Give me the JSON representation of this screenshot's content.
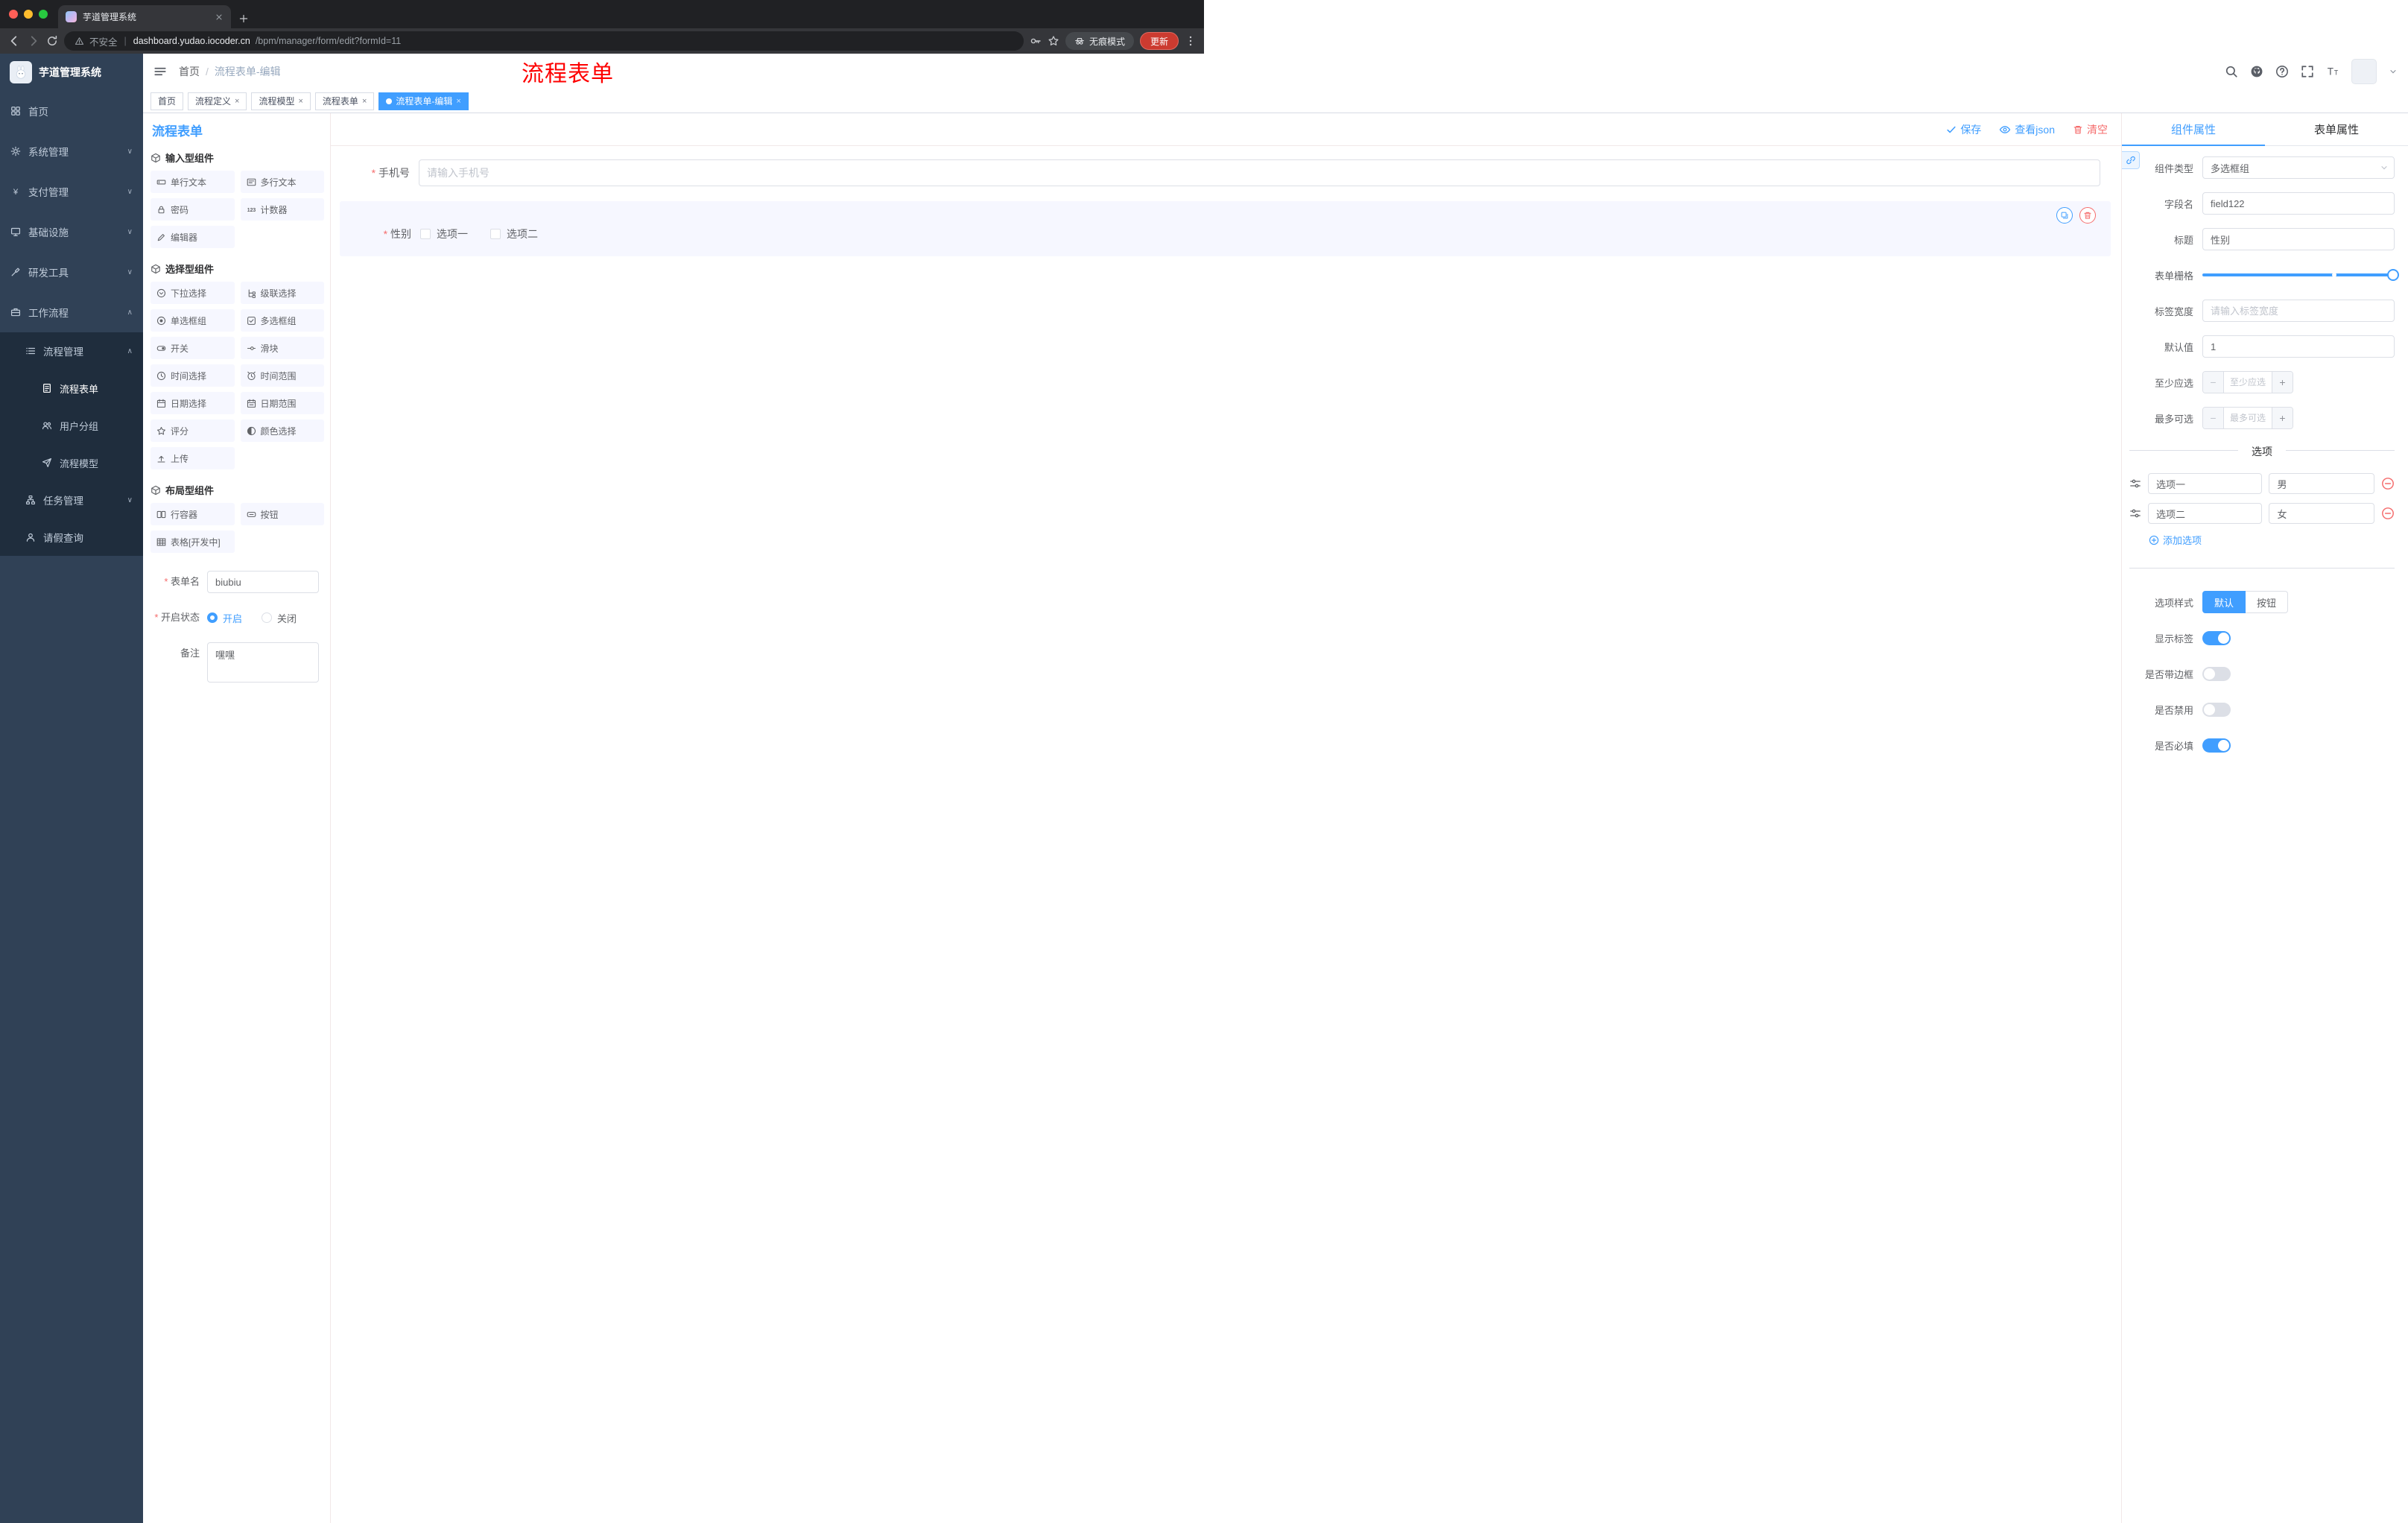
{
  "colors": {
    "accent": "#409eff",
    "danger": "#f56c6c",
    "annotation_red": "#fe0000",
    "sidebar_bg": "#304156",
    "sidebar_submenu_bg": "#1f2d3d",
    "update_button": "#cc3b30",
    "palette_item_bg": "#f6f7ff"
  },
  "browser": {
    "tab_title": "芋道管理系统",
    "security_label": "不安全",
    "url_domain": "dashboard.yudao.iocoder.cn",
    "url_path": "/bpm/manager/form/edit?formId=11",
    "incognito_label": "无痕模式",
    "update_label": "更新"
  },
  "sidebar": {
    "logo_title": "芋道管理系统",
    "items": [
      {
        "label": "首页",
        "icon": "#i-home",
        "chevron": ""
      },
      {
        "label": "系统管理",
        "icon": "#i-gear",
        "chevron": "∨"
      },
      {
        "label": "支付管理",
        "icon": "#i-yen",
        "chevron": "∨"
      },
      {
        "label": "基础设施",
        "icon": "#i-monitor",
        "chevron": "∨"
      },
      {
        "label": "研发工具",
        "icon": "#i-tool",
        "chevron": "∨"
      },
      {
        "label": "工作流程",
        "icon": "#i-case",
        "chevron": "∧"
      },
      {
        "label": "流程管理",
        "icon": "#i-list",
        "chevron": "∧"
      },
      {
        "label": "流程表单",
        "icon": "#i-doc",
        "chevron": ""
      },
      {
        "label": "用户分组",
        "icon": "#i-users",
        "chevron": ""
      },
      {
        "label": "流程模型",
        "icon": "#i-plane",
        "chevron": ""
      },
      {
        "label": "任务管理",
        "icon": "#i-tree",
        "chevron": "∨"
      },
      {
        "label": "请假查询",
        "icon": "#i-user",
        "chevron": ""
      }
    ]
  },
  "header": {
    "breadcrumb_home": "首页",
    "breadcrumb_separator": "/",
    "breadcrumb_current": "流程表单-编辑",
    "annotation": "流程表单"
  },
  "tags": [
    {
      "label": "首页"
    },
    {
      "label": "流程定义"
    },
    {
      "label": "流程模型"
    },
    {
      "label": "流程表单"
    },
    {
      "label": "流程表单-编辑"
    }
  ],
  "designer": {
    "panel_title": "流程表单",
    "toolbar": {
      "save": "保存",
      "view_json": "查看json",
      "clear": "清空"
    },
    "palette": {
      "sections": [
        {
          "title": "输入型组件",
          "items": [
            {
              "label": "单行文本",
              "icon": "#i-input"
            },
            {
              "label": "多行文本",
              "icon": "#i-textarea"
            },
            {
              "label": "密码",
              "icon": "#i-lock"
            },
            {
              "label": "计数器",
              "icon": "#i-counter"
            },
            {
              "label": "编辑器",
              "icon": "#i-editor"
            }
          ]
        },
        {
          "title": "选择型组件",
          "items": [
            {
              "label": "下拉选择",
              "icon": "#i-select"
            },
            {
              "label": "级联选择",
              "icon": "#i-cascader"
            },
            {
              "label": "单选框组",
              "icon": "#i-radio"
            },
            {
              "label": "多选框组",
              "icon": "#i-checkbox"
            },
            {
              "label": "开关",
              "icon": "#i-switch"
            },
            {
              "label": "滑块",
              "icon": "#i-slider"
            },
            {
              "label": "时间选择",
              "icon": "#i-time"
            },
            {
              "label": "时间范围",
              "icon": "#i-time-range"
            },
            {
              "label": "日期选择",
              "icon": "#i-date"
            },
            {
              "label": "日期范围",
              "icon": "#i-date-range"
            },
            {
              "label": "评分",
              "icon": "#i-star"
            },
            {
              "label": "颜色选择",
              "icon": "#i-color"
            },
            {
              "label": "上传",
              "icon": "#i-upload"
            }
          ]
        },
        {
          "title": "布局型组件",
          "items": [
            {
              "label": "行容器",
              "icon": "#i-row"
            },
            {
              "label": "按钮",
              "icon": "#i-button"
            },
            {
              "label": "表格[开发中]",
              "icon": "#i-table"
            }
          ]
        }
      ],
      "form": {
        "name_label": "表单名",
        "name_value": "biubiu",
        "status_label": "开启状态",
        "status_on": "开启",
        "status_off": "关闭",
        "remark_label": "备注",
        "remark_value": "嘿嘿"
      }
    },
    "canvas": {
      "phone_label": "手机号",
      "phone_placeholder": "请输入手机号",
      "gender_label": "性别",
      "gender_option_1": "选项一",
      "gender_option_2": "选项二"
    },
    "properties": {
      "tab_component": "组件属性",
      "tab_form": "表单属性",
      "component_type_label": "组件类型",
      "component_type_value": "多选框组",
      "field_name_label": "字段名",
      "field_name_value": "field122",
      "title_label": "标题",
      "title_value": "性别",
      "grid_label": "表单栅格",
      "label_width_label": "标签宽度",
      "label_width_placeholder": "请输入标签宽度",
      "default_label": "默认值",
      "default_value": "1",
      "min_label": "至少应选",
      "min_placeholder": "至少应选",
      "max_label": "最多可选",
      "max_placeholder": "最多可选",
      "options_title": "选项",
      "options": [
        {
          "label": "选项一",
          "value": "男"
        },
        {
          "label": "选项二",
          "value": "女"
        }
      ],
      "add_option_label": "添加选项",
      "style_label": "选项样式",
      "style_default": "默认",
      "style_button": "按钮",
      "toggles": [
        {
          "label": "显示标签",
          "on": true
        },
        {
          "label": "是否带边框",
          "on": false
        },
        {
          "label": "是否禁用",
          "on": false
        },
        {
          "label": "是否必填",
          "on": true
        }
      ]
    }
  }
}
